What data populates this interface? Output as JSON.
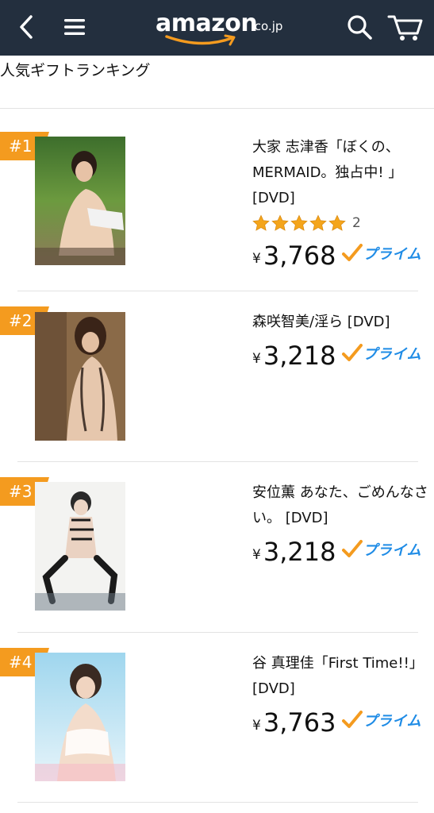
{
  "header": {
    "logo_word": "amazon",
    "logo_tld": ".co.jp",
    "icons": [
      "chevron-left-icon",
      "hamburger-menu-icon",
      "search-icon",
      "cart-icon"
    ],
    "colors": {
      "bar": "#232f3e",
      "smile": "#f49b1f"
    }
  },
  "page": {
    "title": "人気ギフトランキング"
  },
  "badge_color": "#f49b1f",
  "prime_color": "#1f8ce6",
  "items": [
    {
      "rank": "#1",
      "title": "大家 志津香「ぼくの、MERMAID。独占中! 」[DVD]",
      "rating": 5,
      "rating_count": "2",
      "yen": "¥",
      "price": "3,768",
      "prime": "プライム"
    },
    {
      "rank": "#2",
      "title": "森咲智美/淫ら [DVD]",
      "yen": "¥",
      "price": "3,218",
      "prime": "プライム"
    },
    {
      "rank": "#3",
      "title": "安位薫 あなた、ごめんなさい。 [DVD]",
      "yen": "¥",
      "price": "3,218",
      "prime": "プライム"
    },
    {
      "rank": "#4",
      "title": "谷 真理佳「First Time!!」 [DVD]",
      "yen": "¥",
      "price": "3,763",
      "prime": "プライム"
    }
  ]
}
